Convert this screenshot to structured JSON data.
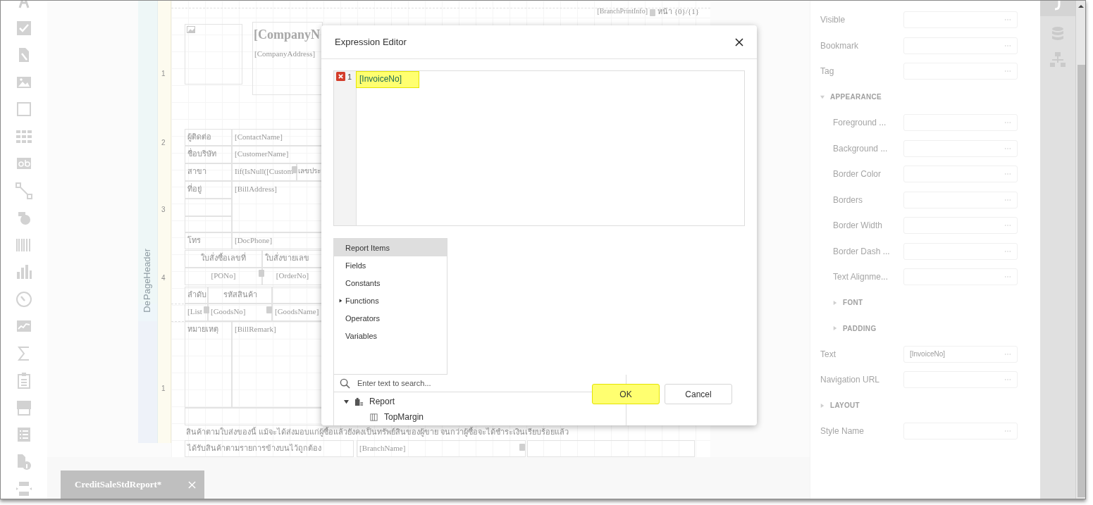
{
  "report_tab": {
    "title": "CreditSaleStdReport*"
  },
  "design_surface": {
    "bands": [
      {
        "label": "PageHeader"
      },
      {
        "label": "De"
      }
    ],
    "ruler_marks": [
      "1",
      "2",
      "3",
      "4",
      "1"
    ],
    "controls": [
      {
        "kind": "picture"
      },
      {
        "kind": "title",
        "text": "[CompanyN"
      },
      {
        "kind": "field",
        "text": "[CompanyAddress]"
      },
      {
        "kind": "field",
        "text": "[BranchPrintInfo]"
      },
      {
        "kind": "caption",
        "text": "หน้า {0}/{1}"
      },
      {
        "kind": "caption",
        "text": "ผู้ติดต่อ"
      },
      {
        "kind": "field",
        "text": "[ContactName]"
      },
      {
        "kind": "caption",
        "text": "ชื่อบริษัท"
      },
      {
        "kind": "field",
        "text": "[CustomerName]"
      },
      {
        "kind": "caption",
        "text": "สาขา"
      },
      {
        "kind": "field",
        "text": "Iif(IsNull([Custom"
      },
      {
        "kind": "caption",
        "text": "เลขประ"
      },
      {
        "kind": "caption",
        "text": "ที่อยู่"
      },
      {
        "kind": "field",
        "text": "[BillAddress]"
      },
      {
        "kind": "caption",
        "text": "โทร"
      },
      {
        "kind": "field",
        "text": "[DocPhone]"
      },
      {
        "kind": "caption",
        "text": "ใบสั่งซื้อเลขที่"
      },
      {
        "kind": "caption",
        "text": "ใบสั่งขายเลข"
      },
      {
        "kind": "field",
        "text": "[PONo]"
      },
      {
        "kind": "field",
        "text": "[OrderNo]"
      },
      {
        "kind": "caption",
        "text": "ลำดับ"
      },
      {
        "kind": "caption",
        "text": "รหัสสินค้า"
      },
      {
        "kind": "field",
        "text": "[List"
      },
      {
        "kind": "field",
        "text": "[GoodsNo]"
      },
      {
        "kind": "field",
        "text": "[GoodsName]"
      },
      {
        "kind": "caption",
        "text": "หมายเหตุ"
      },
      {
        "kind": "field",
        "text": "[BillRemark]"
      },
      {
        "kind": "caption",
        "text": "สินค้าตามใบส่งของนี้ แม้จะได้ส่งมอบแก่ผู้ซื้อแล้วยังคงเป็นทรัพย์สินของผู้ขาย จนกว่าผู้ซื้อจะได้ชำระเงินเรียบร้อยแล้ว"
      },
      {
        "kind": "caption",
        "text": "ได้รับสินค้าตามรายการข้างบนไว้ถูกต้อง"
      },
      {
        "kind": "field",
        "text": "[BranchName]"
      }
    ]
  },
  "properties": [
    {
      "kind": "property",
      "label": "Visible"
    },
    {
      "kind": "property",
      "label": "Bookmark"
    },
    {
      "kind": "property",
      "label": "Tag"
    },
    {
      "kind": "section",
      "label": "APPEARANCE",
      "expanded": true,
      "children": [
        {
          "kind": "property",
          "label": "Foreground ..."
        },
        {
          "kind": "property",
          "label": "Background ..."
        },
        {
          "kind": "property",
          "label": "Border Color"
        },
        {
          "kind": "property",
          "label": "Borders"
        },
        {
          "kind": "property",
          "label": "Border Width"
        },
        {
          "kind": "property",
          "label": "Border Dash ..."
        },
        {
          "kind": "property",
          "label": "Text Alignme..."
        },
        {
          "kind": "section",
          "label": "FONT",
          "expanded": false
        },
        {
          "kind": "section",
          "label": "PADDING",
          "expanded": false
        }
      ]
    },
    {
      "kind": "property",
      "label": "Text",
      "value": "[InvoiceNo]"
    },
    {
      "kind": "property",
      "label": "Navigation URL"
    },
    {
      "kind": "section",
      "label": "LAYOUT",
      "expanded": false
    },
    {
      "kind": "property",
      "label": "Style Name"
    }
  ],
  "dialog": {
    "title": "Expression Editor",
    "editor": {
      "line_number": "1",
      "has_error": true,
      "expression": "[InvoiceNo]",
      "highlighted": true
    },
    "categories": [
      {
        "label": "Report Items",
        "selected": true
      },
      {
        "label": "Fields",
        "selected": false
      },
      {
        "label": "Constants",
        "selected": false
      },
      {
        "label": "Functions",
        "selected": false,
        "expandable": true
      },
      {
        "label": "Operators",
        "selected": false
      },
      {
        "label": "Variables",
        "selected": false
      }
    ],
    "search": {
      "placeholder": "Enter text to search..."
    },
    "tree": [
      {
        "label": "Report",
        "expanded": true,
        "children": [
          {
            "label": "TopMargin"
          }
        ]
      }
    ],
    "buttons": [
      {
        "label": "OK",
        "kind": "primary",
        "highlighted": true
      },
      {
        "label": "Cancel",
        "kind": "secondary",
        "highlighted": false
      }
    ]
  }
}
